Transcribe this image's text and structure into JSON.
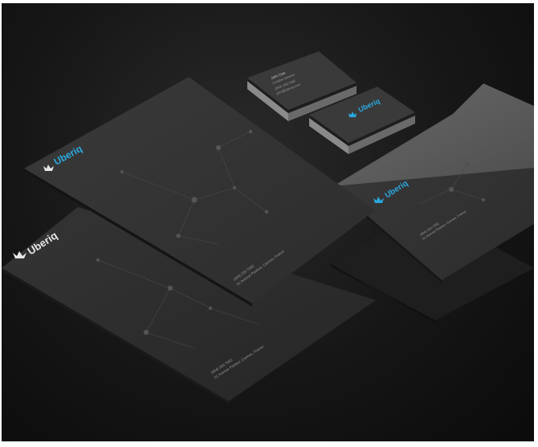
{
  "brand": {
    "name": "Uberiq",
    "accent_color": "#2aa9e0",
    "white_color": "#e8e8e8"
  },
  "letterhead_top": {
    "logo_text": "Uberiq",
    "footer_line1": "(904) 203-7082",
    "footer_line2": "61 Avenue Pasteur, Cannes, France"
  },
  "letterhead_bottom": {
    "logo_text": "Uberiq",
    "footer_line1": "(904) 203-7082",
    "footer_line2": "61 Avenue Pasteur, Cannes, France"
  },
  "business_card_back": {
    "line1": "John Doe",
    "line2": "Creative Director",
    "line3": "(904) 203-7082",
    "line4": "john@uberiq.com"
  },
  "business_card_front": {
    "logo_text": "Uberiq"
  },
  "envelope": {
    "logo_text": "Uberiq",
    "line1": "(904) 203-7082",
    "line2": "61 Avenue Pasteur, Cannes, France"
  }
}
